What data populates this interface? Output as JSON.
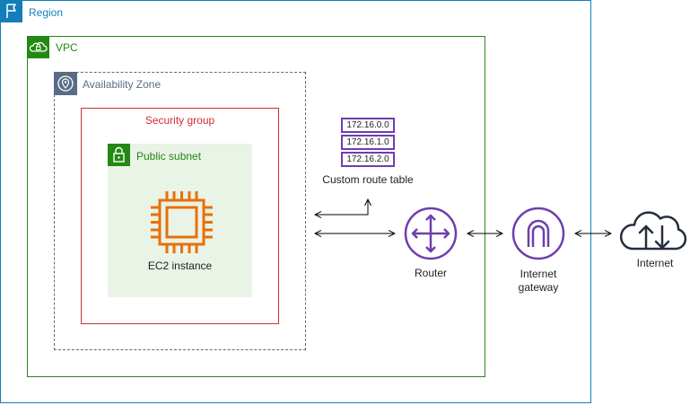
{
  "region": {
    "label": "Region",
    "icon": "flag-icon",
    "color": "#147eba"
  },
  "vpc": {
    "label": "VPC",
    "icon": "cloud-lock-icon",
    "color": "#248814"
  },
  "availability_zone": {
    "label": "Availability Zone",
    "icon": "location-pin-icon",
    "color": "#5a6b86"
  },
  "security_group": {
    "label": "Security group",
    "color": "#d32f2f"
  },
  "public_subnet": {
    "label": "Public subnet",
    "icon": "padlock-icon",
    "color": "#248814",
    "fill": "#e9f3e6"
  },
  "ec2": {
    "label": "EC2 instance",
    "icon": "chip-icon",
    "color": "#e8700a"
  },
  "route_table": {
    "label": "Custom route table",
    "rows": [
      "172.16.0.0",
      "172.16.1.0",
      "172.16.2.0"
    ],
    "color": "#6e3ead"
  },
  "router": {
    "label": "Router",
    "icon": "router-icon",
    "color": "#6e3ead"
  },
  "internet_gateway": {
    "label": "Internet gateway",
    "icon": "gateway-icon",
    "color": "#6e3ead"
  },
  "internet": {
    "label": "Internet",
    "icon": "cloud-updown-icon",
    "color": "#232f3e"
  }
}
